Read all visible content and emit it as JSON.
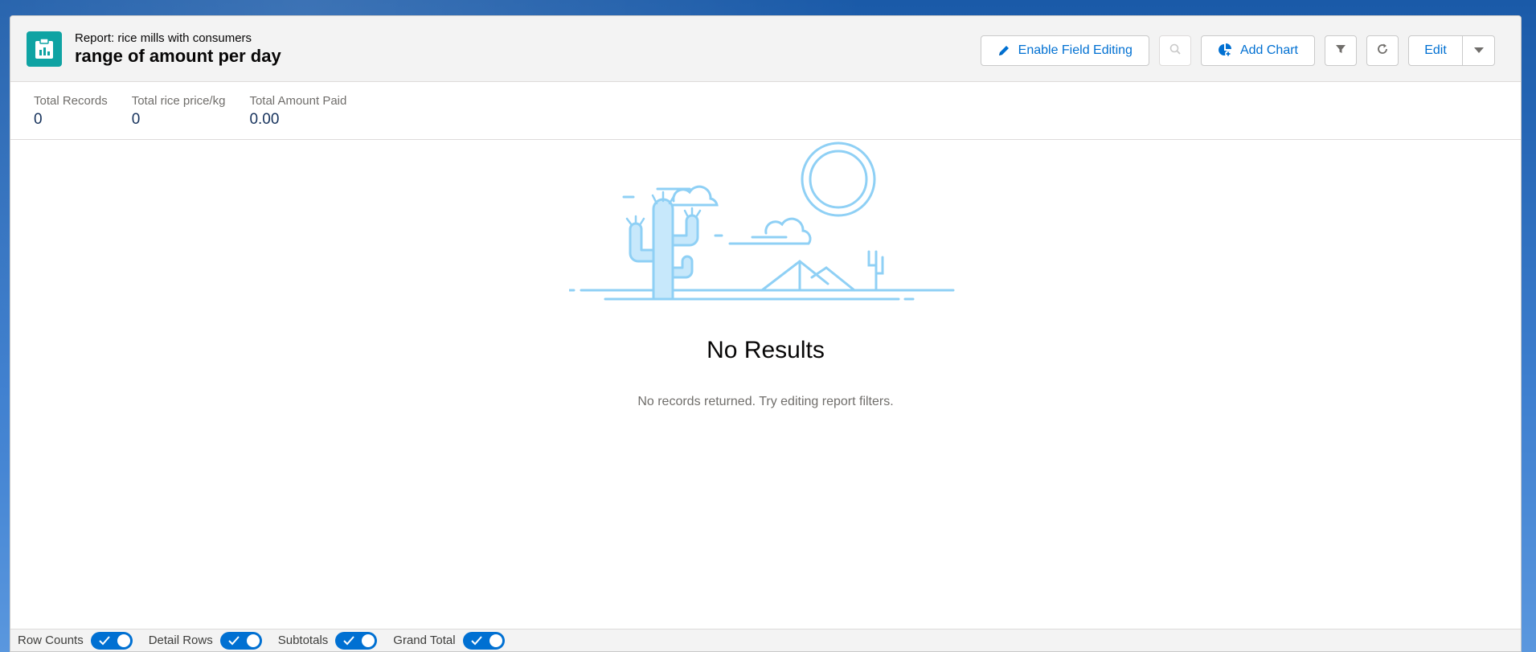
{
  "header": {
    "subtitle": "Report: rice mills with consumers",
    "title": "range of amount per day",
    "icon": "report-icon"
  },
  "actions": {
    "enable_field_editing": "Enable Field Editing",
    "add_chart": "Add Chart",
    "edit": "Edit"
  },
  "summary": [
    {
      "label": "Total Records",
      "value": "0"
    },
    {
      "label": "Total rice price/kg",
      "value": "0"
    },
    {
      "label": "Total Amount Paid",
      "value": "0.00"
    }
  ],
  "empty_state": {
    "heading": "No Results",
    "message": "No records returned. Try editing report filters."
  },
  "footer": {
    "toggles": [
      {
        "label": "Row Counts",
        "on": true
      },
      {
        "label": "Detail Rows",
        "on": true
      },
      {
        "label": "Subtotals",
        "on": true
      },
      {
        "label": "Grand Total",
        "on": true
      }
    ]
  },
  "colors": {
    "accent": "#0070d2",
    "report_icon_bg": "#0fa3a3",
    "illustration": "#8fd0f5"
  }
}
